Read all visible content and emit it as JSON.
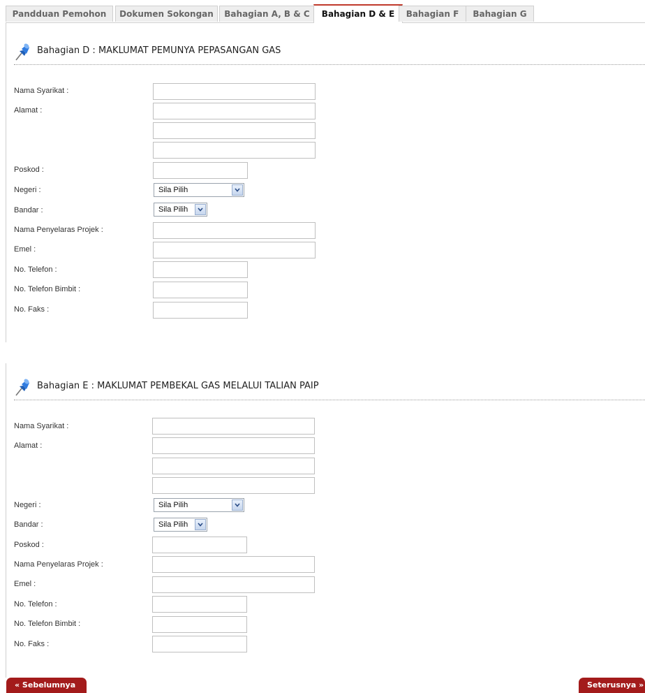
{
  "tabs": [
    {
      "label": "Pandduan Pemohon",
      "active": false
    },
    {
      "label": "Dokumen Sokongan",
      "active": false
    },
    {
      "label": "Bahagian A, B & C",
      "active": false
    },
    {
      "label": "Bahagian D & E",
      "active": true
    },
    {
      "label": "Bahagian F",
      "active": false
    },
    {
      "label": "Bahagian G",
      "active": false
    }
  ],
  "section_d": {
    "title": "Bahagian D : MAKLUMAT PEMUNYA PEPASANGAN GAS",
    "labels": {
      "nama_syarikat": "Nama Syarikat :",
      "alamat": "Alamat :",
      "poskod": "Poskod :",
      "negeri": "Negeri :",
      "bandar": "Bandar :",
      "nama_penyelaras": "Nama Penyelaras Projek :",
      "emel": "Emel :",
      "telefon": "No. Telefon :",
      "telefon_bimbit": "No. Telefon Bimbit :",
      "faks": "No. Faks :"
    },
    "negeri_selected": "Sila Pilih",
    "bandar_selected": "Sila Pilih"
  },
  "section_e": {
    "title": "Bahagian E : MAKLUMAT PEMBEKAL GAS MELALUI TALIAN PAIP",
    "labels": {
      "nama_syarikat": "Nama Syarikat :",
      "alamat": "Alamat :",
      "negeri": "Negeri :",
      "bandar": "Bandar :",
      "poskod": "Poskod :",
      "nama_penyelaras": "Nama Penyelaras Projek :",
      "emel": "Emel :",
      "telefon": "No. Telefon :",
      "telefon_bimbit": "No. Telefon Bimbit :",
      "faks": "No. Faks :"
    },
    "negeri_selected": "Sila Pilih",
    "bandar_selected": "Sila Pilih"
  },
  "nav": {
    "prev_label": "« Sebelumnya",
    "next_label": "Seterusnya »"
  },
  "colors": {
    "accent": "#a31b1b",
    "active_tab_border": "#c0392b"
  },
  "icons": {
    "section_icon": "pushpin-icon",
    "select_arrow": "chevron-down-icon"
  }
}
